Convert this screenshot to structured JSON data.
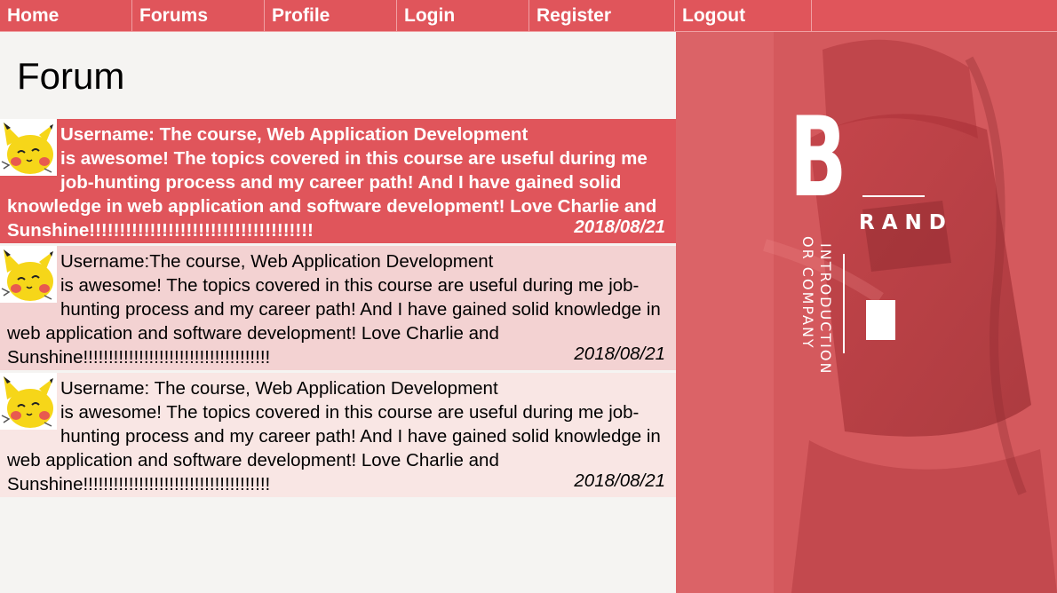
{
  "nav": {
    "items": [
      {
        "label": "Home"
      },
      {
        "label": "Forums"
      },
      {
        "label": "Profile"
      },
      {
        "label": "Login"
      },
      {
        "label": "Register"
      },
      {
        "label": "Logout"
      }
    ]
  },
  "page": {
    "title": "Forum"
  },
  "posts": [
    {
      "line1": "Username: The course, Web Application Development",
      "body": "is awesome! The topics covered in this course are useful during me job-hunting process and my career path! And I have gained solid knowledge in web application and software development! Love Charlie and Sunshine!!!!!!!!!!!!!!!!!!!!!!!!!!!!!!!!!!!!!",
      "date": "2018/08/21"
    },
    {
      "line1": "Username:The course, Web Application Development",
      "body": "is awesome! The topics covered in this course are useful during me job-hunting process and my career path! And I have gained solid knowledge in web application and software development! Love Charlie and Sunshine!!!!!!!!!!!!!!!!!!!!!!!!!!!!!!!!!!!!!",
      "date": "2018/08/21"
    },
    {
      "line1": "Username: The course, Web Application Development",
      "body": "is awesome! The topics covered in this course are useful during me job-hunting process and my career path! And I have gained solid knowledge in web application and software development! Love Charlie and Sunshine!!!!!!!!!!!!!!!!!!!!!!!!!!!!!!!!!!!!!",
      "date": "2018/08/21"
    }
  ],
  "brand": {
    "letter": "B",
    "word": "RAND",
    "vertical_line1": "INTRODUCTION",
    "vertical_line2": "OR COMPANY"
  },
  "colors": {
    "accent": "#e0555b",
    "row2": "#f3d2d2",
    "row3": "#f9e6e4"
  },
  "icons": {
    "avatar": "pikachu-avatar-icon"
  }
}
